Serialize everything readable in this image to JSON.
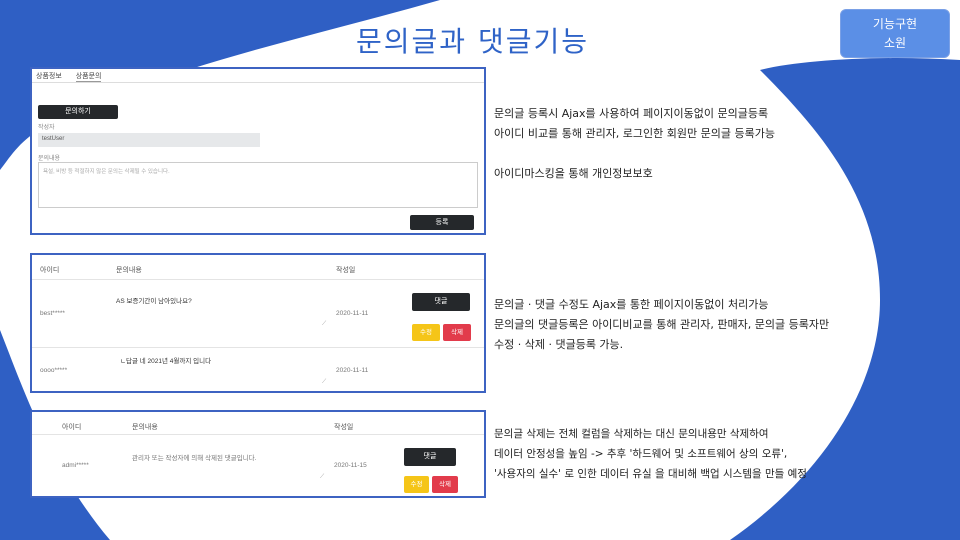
{
  "title": "문의글과 댓글기능",
  "tag": {
    "line1": "기능구현",
    "line2": "소원"
  },
  "shot1": {
    "tabs": [
      "상품정보",
      "상품문의"
    ],
    "write_button": "문의하기",
    "writer_label": "작성자",
    "writer_value": "testUser",
    "content_label": "문의내용",
    "content_placeholder": "욕설, 비방 등 적절하지 않은 문의는 삭제될 수 있습니다.",
    "submit_button": "등록"
  },
  "shot2": {
    "headers": {
      "id": "아이디",
      "content": "문의내용",
      "date": "작성일"
    },
    "rows": [
      {
        "id": "best*****",
        "content": "AS 보증기간이 남아있나요?",
        "date": "2020-11-11"
      },
      {
        "id": "oooo*****",
        "content": "ㄴ답글 네 2021년 4월까지 입니다",
        "date": "2020-11-11"
      }
    ],
    "reply_button": "댓글",
    "edit_button": "수정",
    "delete_button": "삭제"
  },
  "shot3": {
    "headers": {
      "id": "아이디",
      "content": "문의내용",
      "date": "작성일"
    },
    "rows": [
      {
        "id": "admi*****",
        "content": "관리자 또는 작성자에 의해 삭제된 댓글입니다.",
        "date": "2020-11-15"
      }
    ],
    "reply_button": "댓글",
    "edit_button": "수정",
    "delete_button": "삭제"
  },
  "desc1": {
    "lines": [
      "문의글 등록시 Ajax를 사용하여 페이지이동없이 문의글등록",
      "아이디 비교를 통해 관리자, 로그인한 회원만 문의글 등록가능",
      "",
      "아이디마스킹을 통해 개인정보보호"
    ]
  },
  "desc2": {
    "lines": [
      "문의글 · 댓글 수정도 Ajax를 통한 페이지이동없이 처리가능",
      "문의글의 댓글등록은 아이디비교를 통해 관리자, 판매자, 문의글 등록자만",
      "수정 · 삭제 · 댓글등록 가능."
    ]
  },
  "desc3": {
    "lines": [
      "문의글 삭제는 전체 컬럼을 삭제하는 대신 문의내용만 삭제하여",
      "데이터 안정성을 높임 -> 추후 '하드웨어 및 소프트웨어 상의 오류',",
      "'사용자의 실수' 로 인한 데이터 유실 을 대비해 백업 시스템을 만들 예정"
    ]
  },
  "colors": {
    "accent": "#2f63c7",
    "blob": "#2f5fc4",
    "tag_bg": "#5b8fe6"
  }
}
